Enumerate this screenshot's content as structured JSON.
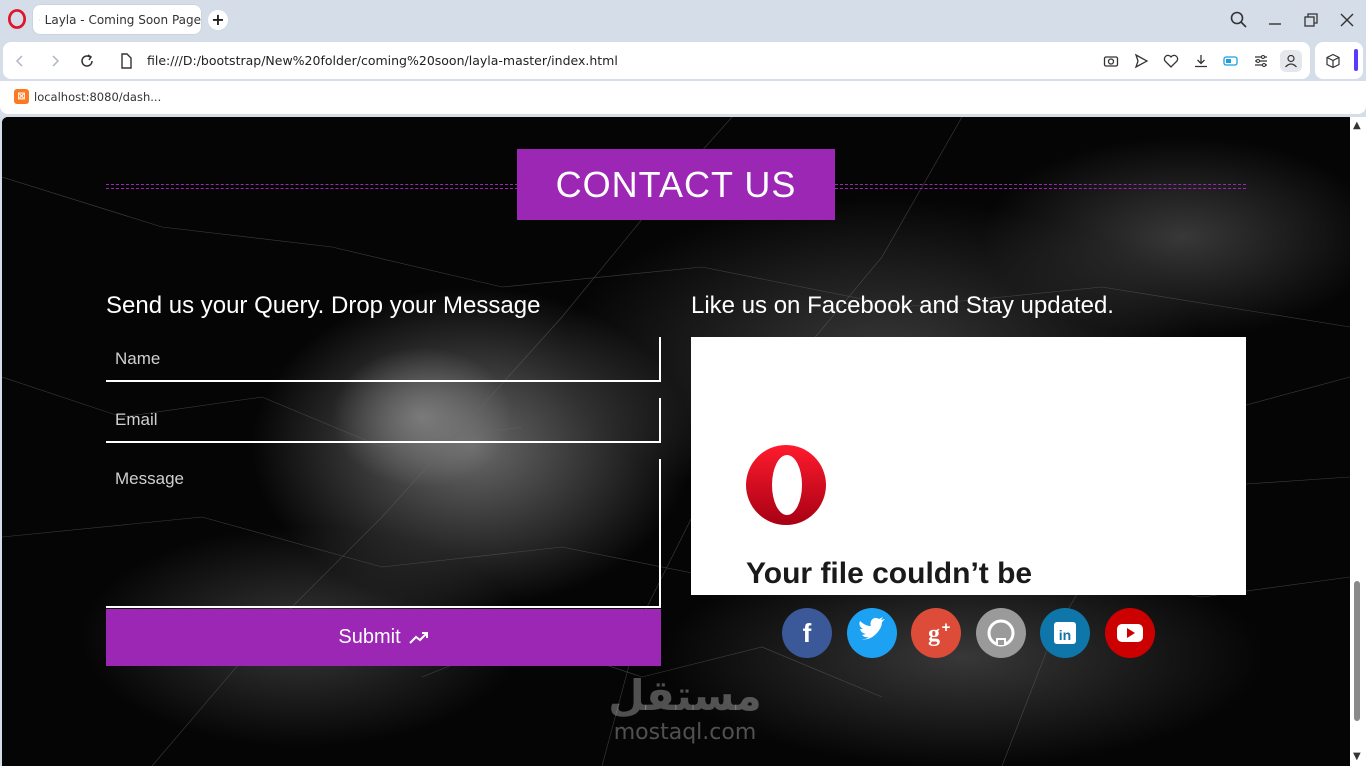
{
  "browser": {
    "tab_title": "Layla - Coming Soon Page",
    "url": "file:///D:/bootstrap/New%20folder/coming%20soon/layla-master/index.html",
    "bookmark_label": "localhost:8080/dash..."
  },
  "page": {
    "contact_title": "CONTACT US",
    "form_heading": "Send us your Query. Drop your Message",
    "fb_heading": "Like us on Facebook and Stay updated.",
    "name_placeholder": "Name",
    "email_placeholder": "Email",
    "message_placeholder": "Message",
    "submit_label": "Submit",
    "fb_error": "Your file couldn’t be",
    "social": [
      {
        "icon": "facebook-icon",
        "color": "#3b5998"
      },
      {
        "icon": "twitter-icon",
        "color": "#1da1f2"
      },
      {
        "icon": "google-plus-icon",
        "color": "#dd4b39"
      },
      {
        "icon": "github-icon",
        "color": "#9a9a9a"
      },
      {
        "icon": "linkedin-icon",
        "color": "#0e76a8"
      },
      {
        "icon": "youtube-icon",
        "color": "#cc0000"
      }
    ],
    "watermark_arabic": "مستقل",
    "watermark_latin": "mostaql.com"
  },
  "colors": {
    "accent": "#9b27b4",
    "page_bg": "#050505"
  }
}
